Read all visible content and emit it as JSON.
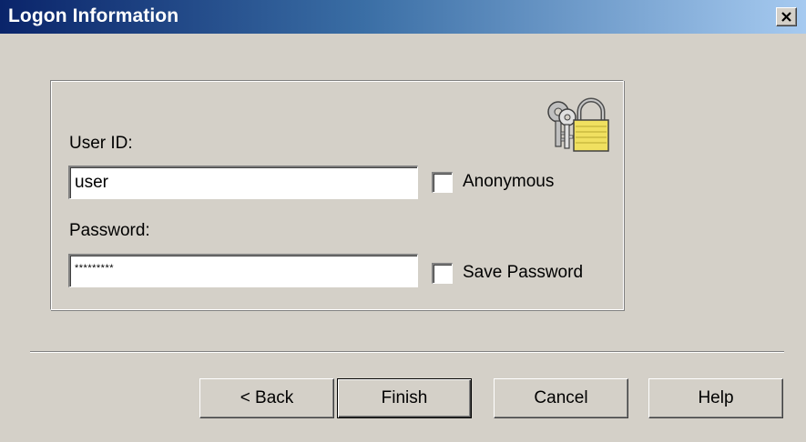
{
  "window": {
    "title": "Logon Information",
    "close_glyph": "×"
  },
  "form": {
    "user_id_label": "User ID:",
    "user_id_value": "user",
    "password_label": "Password:",
    "password_value": "*********",
    "anonymous_label": "Anonymous",
    "anonymous_checked": false,
    "save_password_label": "Save Password",
    "save_password_checked": false,
    "icon": "keys-and-padlock-icon"
  },
  "buttons": {
    "back_label": "< Back",
    "finish_label": "Finish",
    "cancel_label": "Cancel",
    "help_label": "Help"
  },
  "colors": {
    "titlebar_start": "#0a246a",
    "titlebar_end": "#a6caf0",
    "face": "#d4d0c8"
  }
}
